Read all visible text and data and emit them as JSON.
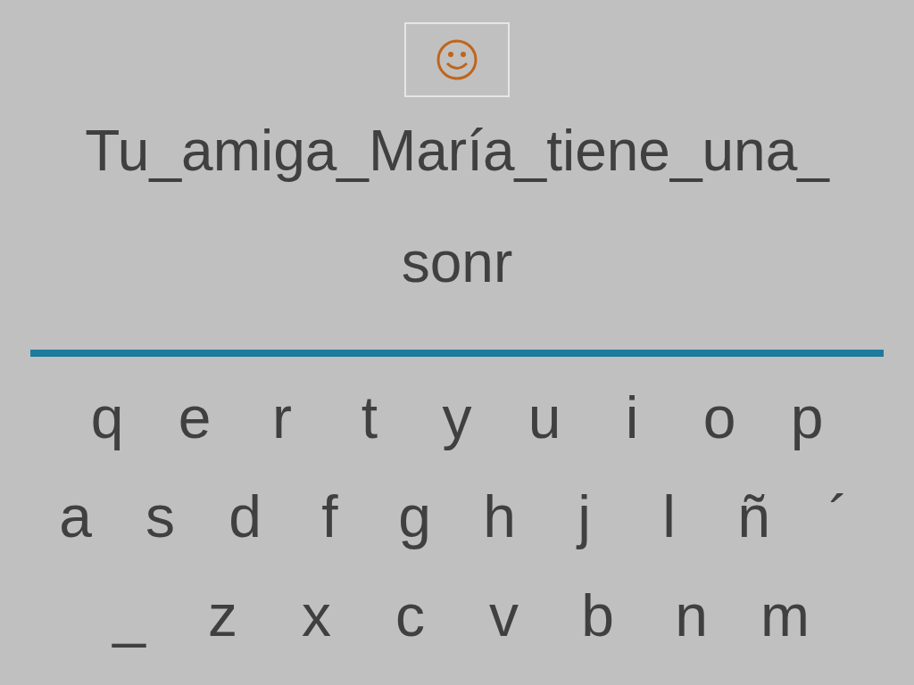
{
  "prompt": "Tu_amiga_María_tiene_una_",
  "answer": "sonr",
  "keyboard": [
    [
      "q",
      "e",
      "r",
      "t",
      "y",
      "u",
      "i",
      "o",
      "p"
    ],
    [
      "a",
      "s",
      "d",
      "f",
      "g",
      "h",
      "j",
      "l",
      "ñ",
      "´"
    ],
    [
      "_",
      "z",
      "x",
      "c",
      "v",
      "b",
      "n",
      "m"
    ]
  ]
}
